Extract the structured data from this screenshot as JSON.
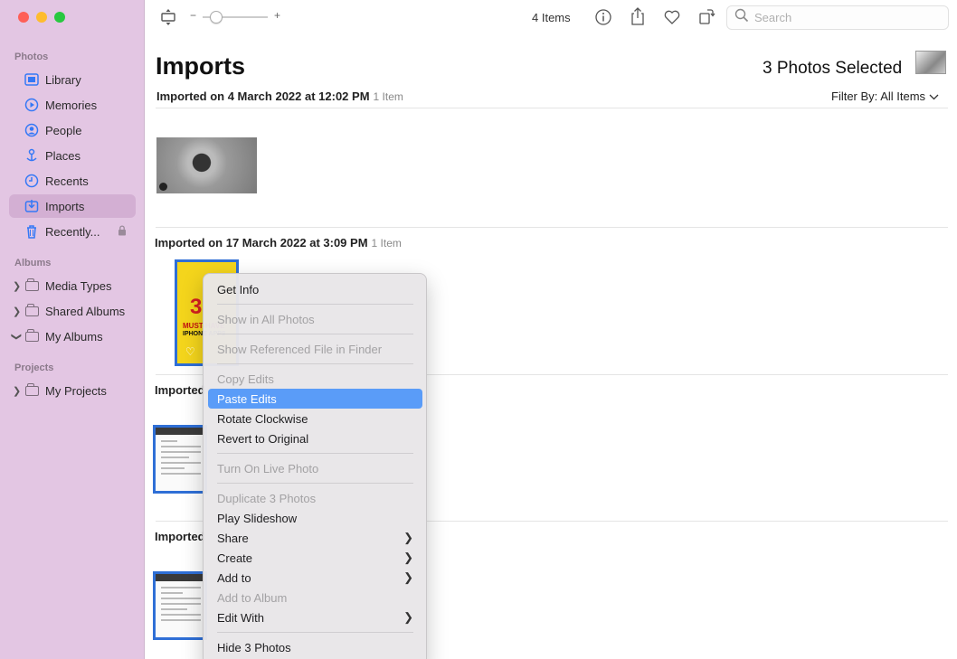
{
  "sidebar": {
    "sections": {
      "photos": "Photos",
      "albums": "Albums",
      "projects": "Projects"
    },
    "photos_items": [
      {
        "label": "Library",
        "icon": "library-icon"
      },
      {
        "label": "Memories",
        "icon": "memories-icon"
      },
      {
        "label": "People",
        "icon": "people-icon"
      },
      {
        "label": "Places",
        "icon": "places-icon"
      },
      {
        "label": "Recents",
        "icon": "recents-icon"
      },
      {
        "label": "Imports",
        "icon": "imports-icon",
        "active": true
      },
      {
        "label": "Recently...",
        "icon": "trash-icon",
        "locked": true
      }
    ],
    "album_items": [
      {
        "label": "Media Types",
        "icon": "folder-icon",
        "chevron": ">"
      },
      {
        "label": "Shared Albums",
        "icon": "folder-icon",
        "chevron": ">"
      },
      {
        "label": "My Albums",
        "icon": "folder-icon",
        "chevron": "v"
      }
    ],
    "project_items": [
      {
        "label": "My Projects",
        "icon": "folder-icon",
        "chevron": ">"
      }
    ]
  },
  "toolbar": {
    "zoom_minus": "−",
    "zoom_plus": "+",
    "item_count": "4 Items",
    "search_placeholder": "Search"
  },
  "main": {
    "title": "Imports",
    "selected_label": "3 Photos Selected",
    "filter_prefix": "Filter By:",
    "filter_value": "All Items",
    "groups": [
      {
        "label": "Imported on 4 March 2022 at 12:02 PM",
        "count": "1 Item"
      },
      {
        "label": "Imported on 17 March 2022 at 3:09 PM",
        "count": "1 Item"
      },
      {
        "label": "Imported"
      },
      {
        "label": "Imported"
      }
    ],
    "yellow_thumb": {
      "number": "3",
      "line1": "MUST-HAVE",
      "line2": "IPHONE APPS"
    }
  },
  "context_menu": {
    "items": [
      {
        "label": "Get Info",
        "enabled": true
      },
      {
        "label": "Show in All Photos",
        "enabled": false
      },
      {
        "label": "Show Referenced File in Finder",
        "enabled": false
      },
      {
        "label": "Copy Edits",
        "enabled": false
      },
      {
        "label": "Paste Edits",
        "enabled": true,
        "highlighted": true
      },
      {
        "label": "Rotate Clockwise",
        "enabled": true
      },
      {
        "label": "Revert to Original",
        "enabled": true
      },
      {
        "label": "Turn On Live Photo",
        "enabled": false
      },
      {
        "label": "Duplicate 3 Photos",
        "enabled": false
      },
      {
        "label": "Play Slideshow",
        "enabled": true
      },
      {
        "label": "Share",
        "enabled": true,
        "submenu": true
      },
      {
        "label": "Create",
        "enabled": true,
        "submenu": true
      },
      {
        "label": "Add to",
        "enabled": true,
        "submenu": true
      },
      {
        "label": "Add to Album",
        "enabled": false
      },
      {
        "label": "Edit With",
        "enabled": true,
        "submenu": true
      },
      {
        "label": "Hide 3 Photos",
        "enabled": true
      }
    ]
  },
  "colors": {
    "sidebar_bg": "#e3c6e3",
    "accent": "#3478f6",
    "selection_border": "#2f6fd6",
    "menu_highlight": "#5a9cf8"
  }
}
